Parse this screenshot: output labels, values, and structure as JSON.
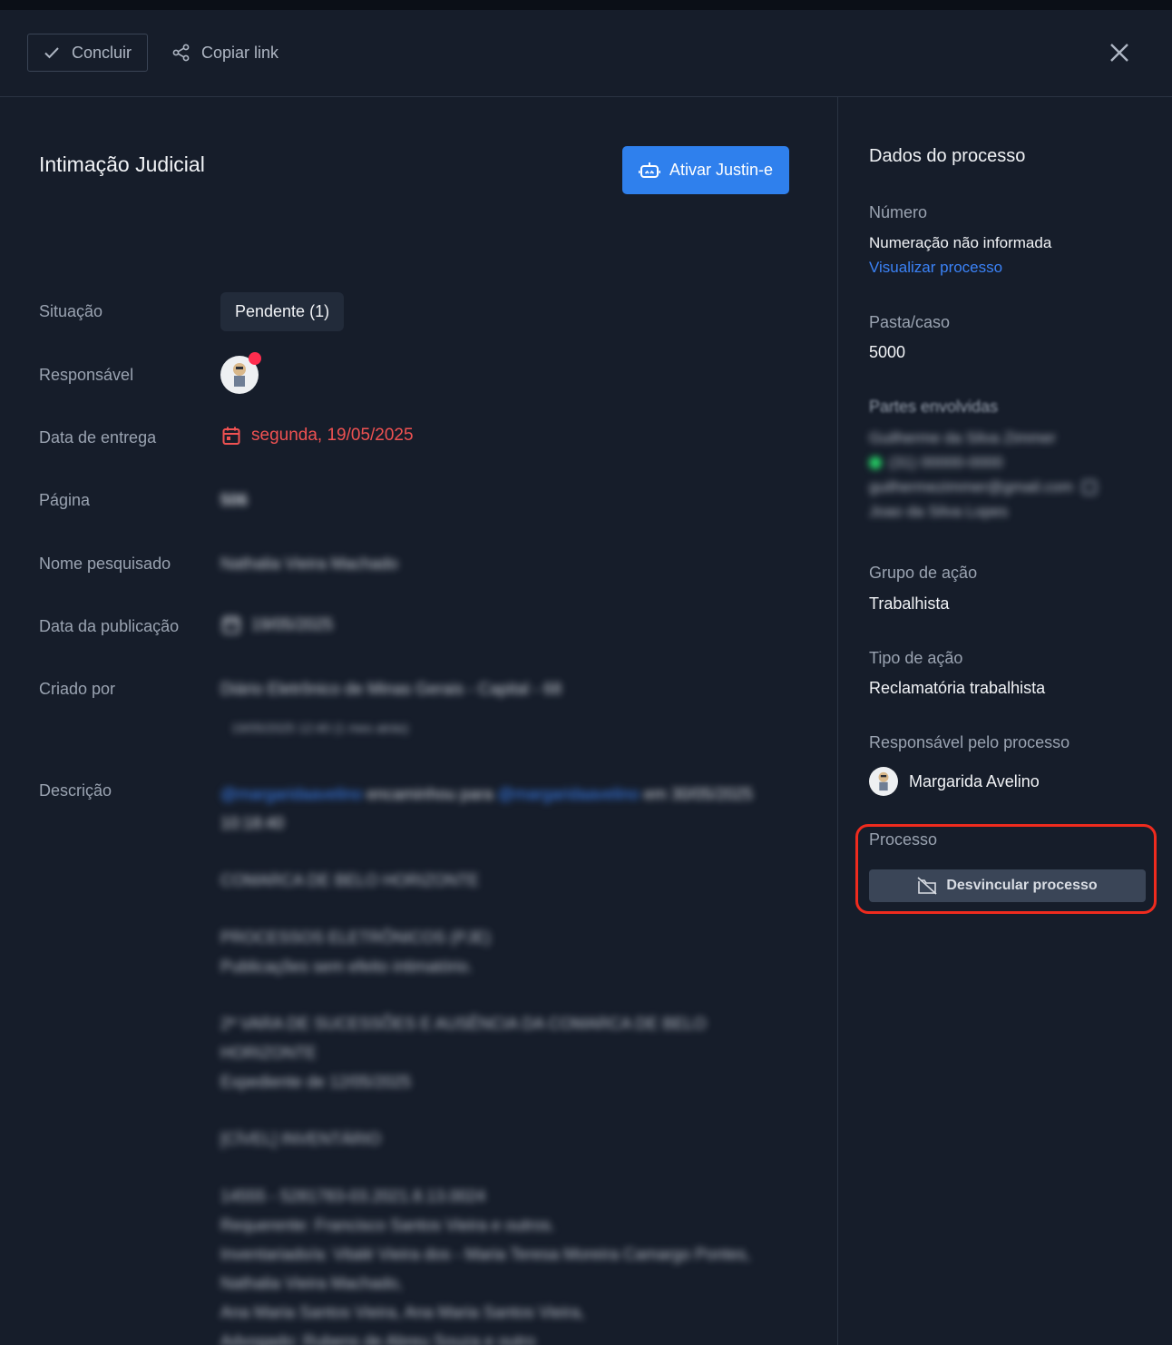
{
  "header": {
    "concluir_label": "Concluir",
    "copiar_label": "Copiar link"
  },
  "main": {
    "title": "Intimação Judicial",
    "justin_label": "Ativar Justin-e",
    "labels": {
      "situacao": "Situação",
      "responsavel": "Responsável",
      "data_entrega": "Data de entrega",
      "pagina": "Página",
      "nome_pesquisado": "Nome pesquisado",
      "data_publicacao": "Data da publicação",
      "criado_por": "Criado por",
      "descricao": "Descrição"
    },
    "situacao_value": "Pendente (1)",
    "data_entrega_value": "segunda, 19/05/2025",
    "pagina_value": "506",
    "nome_pesquisado_value": "Nathalia Vieira Machado",
    "data_publicacao_value": "19/05/2025",
    "criado_por_value": "Diário Eletrônico de Minas Gerais - Capital - 68",
    "criado_por_meta": "19/05/2025 12:40 (1 mes atrás)",
    "descricao": {
      "mention1": "@margaridaavelino",
      "action": " encaminhou para ",
      "mention2": "@margaridaavelino",
      "suffix": " em 30/05/2025 10:18:40",
      "lines": [
        "COMARCA DE BELO HORIZONTE",
        "PROCESSOS ELETRÔNICOS (PJE)",
        "Publicações sem efeito intimatório.",
        "2ª VARA DE SUCESSÕES E AUSÊNCIA DA COMARCA DE BELO HORIZONTE",
        "Expediente de 12/05/2025",
        "[CÍVEL] INVENTÁRIO",
        "14555 - 5281783-03.2021.8.13.0024",
        "Requerente: Francisco Santos Vieira e outros.",
        "Inventariado/a: Vitalé Vieira dos - Maria Teresa Moreira Camargo Pontes, Nathalia Vieira Machado,",
        "Ana Maria Santos Vieira, Ana Maria Santos Vieira,",
        "Advogado: Rubens de Abreu Souza e outro"
      ]
    }
  },
  "sidebar": {
    "title": "Dados do processo",
    "numero_label": "Número",
    "numero_value": "Numeração não informada",
    "visualizar_label": "Visualizar processo",
    "pasta_label": "Pasta/caso",
    "pasta_value": "5000",
    "partes_label": "Partes envolvidas",
    "partes": [
      "Guilherme da Silva Zimmer",
      "(31) 00000-0000",
      "guilhermezimmer@gmail.com",
      "Joao da Silva Lopes"
    ],
    "grupo_label": "Grupo de ação",
    "grupo_value": "Trabalhista",
    "tipo_label": "Tipo de ação",
    "tipo_value": "Reclamatória trabalhista",
    "responsavel_label": "Responsável pelo processo",
    "responsavel_value": "Margarida Avelino",
    "processo_label": "Processo",
    "desvincular_label": "Desvincular processo"
  },
  "colors": {
    "background": "#161d2a",
    "accent": "#2f80ed",
    "danger": "#f05252",
    "highlight": "#ef2b1e"
  }
}
